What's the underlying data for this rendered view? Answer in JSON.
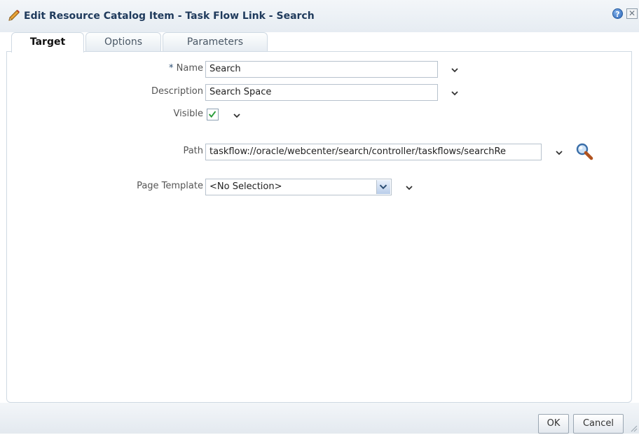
{
  "dialog": {
    "title": "Edit Resource Catalog Item - Task Flow Link - Search",
    "help_symbol": "?",
    "close_symbol": "✕"
  },
  "tabs": [
    {
      "label": "Target",
      "active": true
    },
    {
      "label": "Options",
      "active": false
    },
    {
      "label": "Parameters",
      "active": false
    }
  ],
  "form": {
    "name": {
      "required_mark": "*",
      "label": "Name",
      "value": "Search"
    },
    "description": {
      "label": "Description",
      "value": "Search Space"
    },
    "visible": {
      "label": "Visible",
      "checked": true
    },
    "path": {
      "label": "Path",
      "value": "taskflow://oracle/webcenter/search/controller/taskflows/searchRe"
    },
    "page_template": {
      "label": "Page Template",
      "selected": "<No Selection>"
    }
  },
  "footer": {
    "ok_label": "OK",
    "cancel_label": "Cancel"
  },
  "colors": {
    "accent": "#2f67b9",
    "label_text": "#555555",
    "checkmark": "#2a9d3a",
    "title_text": "#1f3a5c"
  },
  "icons": [
    "pencil-icon",
    "help-icon",
    "close-icon",
    "chevron-down-icon",
    "search-magnifier-icon",
    "checkmark-icon",
    "resize-grip-icon"
  ]
}
